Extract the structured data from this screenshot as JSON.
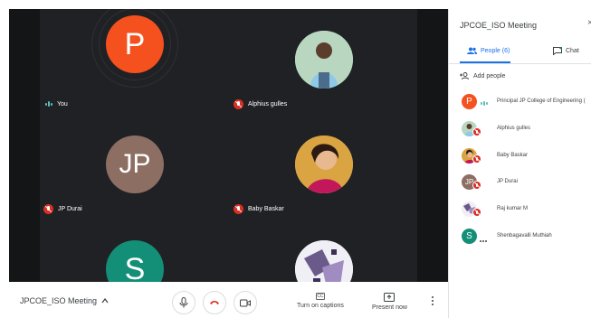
{
  "meeting": {
    "title": "JPCOE_ISO Meeting"
  },
  "tiles": [
    {
      "name": "You",
      "initial": "P",
      "color": "#f4511e",
      "muted": false
    },
    {
      "name": "Alphius gulles",
      "initial": "",
      "color": "#9fc5a8",
      "muted": true
    },
    {
      "name": "JP Durai",
      "initial": "JP",
      "color": "#8d6e63",
      "muted": true
    },
    {
      "name": "Baby Baskar",
      "initial": "",
      "color": "#c0a060",
      "muted": true
    },
    {
      "name": "",
      "initial": "S",
      "color": "#148f77",
      "muted": false
    },
    {
      "name": "",
      "initial": "",
      "color": "#d8d8e8",
      "muted": false
    }
  ],
  "controls": {
    "captions_label": "Turn on captions",
    "captions_icon": "CC",
    "present_label": "Present now"
  },
  "panel": {
    "title": "JPCOE_ISO Meeting",
    "close_glyph": "×",
    "tab_people": "People (6)",
    "tab_chat": "Chat",
    "add_people": "Add people",
    "participants": [
      {
        "name": "Principal JP College of Engineering (",
        "initial": "P",
        "color": "#f4511e",
        "muted": false
      },
      {
        "name": "Alphius gulles",
        "initial": "",
        "color": "#9fc5a8",
        "muted": true
      },
      {
        "name": "Baby Baskar",
        "initial": "",
        "color": "#c0a060",
        "muted": true
      },
      {
        "name": "JP Durai",
        "initial": "JP",
        "color": "#8d6e63",
        "muted": true
      },
      {
        "name": "Raj kumar M",
        "initial": "",
        "color": "#d8d8e8",
        "muted": true
      },
      {
        "name": "Shenbagavalli Muthiah",
        "initial": "S",
        "color": "#148f77",
        "muted": false
      }
    ]
  },
  "icons": [
    "mic-icon",
    "hang-up-icon",
    "camera-icon",
    "captions-icon",
    "present-icon",
    "more-options-icon",
    "people-icon",
    "chat-icon",
    "add-person-icon",
    "chevron-up-icon",
    "close-icon"
  ]
}
